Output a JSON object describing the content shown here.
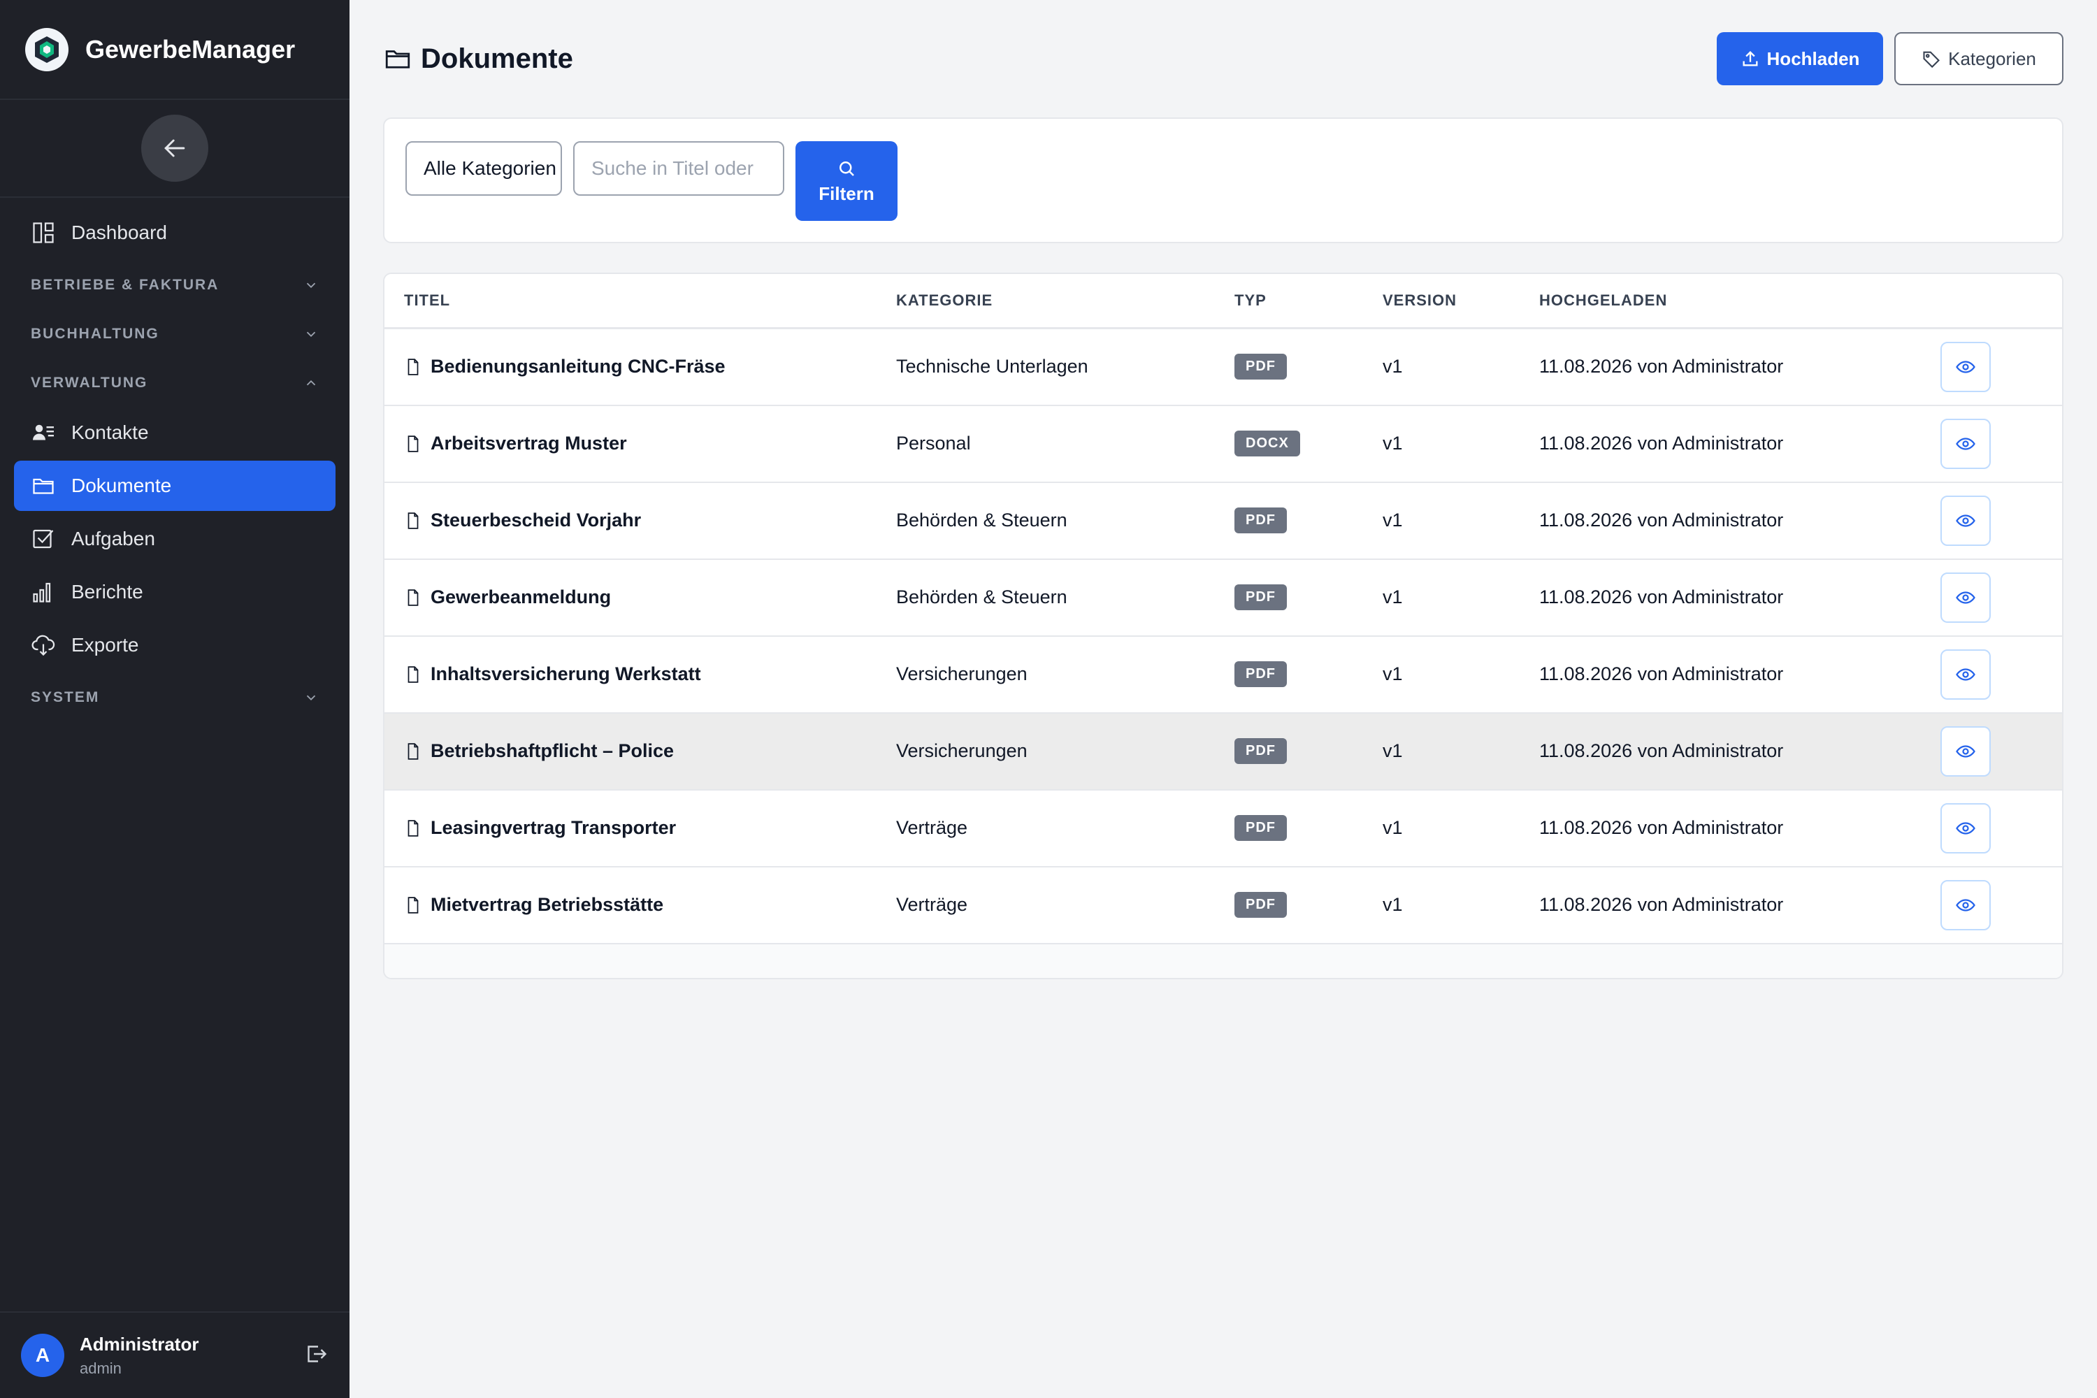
{
  "app": {
    "name": "GewerbeManager"
  },
  "sidebar": {
    "dashboard": "Dashboard",
    "sections": {
      "betriebe": "BETRIEBE & FAKTURA",
      "buchhaltung": "BUCHHALTUNG",
      "verwaltung": "VERWALTUNG",
      "system": "SYSTEM"
    },
    "items": {
      "kontakte": "Kontakte",
      "dokumente": "Dokumente",
      "aufgaben": "Aufgaben",
      "berichte": "Berichte",
      "exporte": "Exporte"
    },
    "user": {
      "initial": "A",
      "name": "Administrator",
      "role": "admin"
    }
  },
  "header": {
    "title": "Dokumente",
    "upload_label": "Hochladen",
    "categories_label": "Kategorien"
  },
  "filter": {
    "category_value": "Alle Kategorien",
    "search_placeholder": "Suche in Titel oder",
    "button_label": "Filtern"
  },
  "table": {
    "headers": {
      "title": "TITEL",
      "category": "KATEGORIE",
      "type": "TYP",
      "version": "VERSION",
      "uploaded": "HOCHGELADEN"
    },
    "rows": [
      {
        "title": "Bedienungsanleitung CNC-Fräse",
        "category": "Technische Unterlagen",
        "type": "PDF",
        "version": "v1",
        "uploaded": "11.08.2026 von Administrator"
      },
      {
        "title": "Arbeitsvertrag Muster",
        "category": "Personal",
        "type": "DOCX",
        "version": "v1",
        "uploaded": "11.08.2026 von Administrator"
      },
      {
        "title": "Steuerbescheid Vorjahr",
        "category": "Behörden & Steuern",
        "type": "PDF",
        "version": "v1",
        "uploaded": "11.08.2026 von Administrator"
      },
      {
        "title": "Gewerbeanmeldung",
        "category": "Behörden & Steuern",
        "type": "PDF",
        "version": "v1",
        "uploaded": "11.08.2026 von Administrator"
      },
      {
        "title": "Inhaltsversicherung Werkstatt",
        "category": "Versicherungen",
        "type": "PDF",
        "version": "v1",
        "uploaded": "11.08.2026 von Administrator"
      },
      {
        "title": "Betriebshaftpflicht – Police",
        "category": "Versicherungen",
        "type": "PDF",
        "version": "v1",
        "uploaded": "11.08.2026 von Administrator"
      },
      {
        "title": "Leasingvertrag Transporter",
        "category": "Verträge",
        "type": "PDF",
        "version": "v1",
        "uploaded": "11.08.2026 von Administrator"
      },
      {
        "title": "Mietvertrag Betriebsstätte",
        "category": "Verträge",
        "type": "PDF",
        "version": "v1",
        "uploaded": "11.08.2026 von Administrator"
      }
    ]
  },
  "colors": {
    "primary": "#2563eb",
    "sidebar_bg": "#1f2128",
    "badge": "#6b7280"
  }
}
